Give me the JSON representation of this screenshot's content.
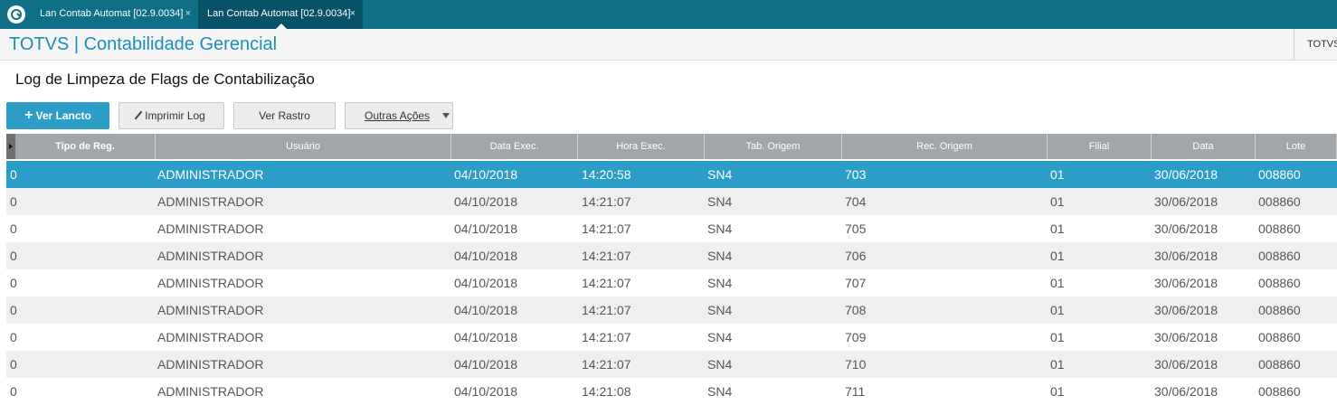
{
  "tabs": [
    {
      "label": "Lan Contab Automat [02.9.0034]",
      "close": "×"
    },
    {
      "label": "Lan Contab Automat [02.9.0034]",
      "close": "×"
    }
  ],
  "header": {
    "brand": "TOTVS | Contabilidade Gerencial",
    "right_label": "TOTVS"
  },
  "page_title": "Log de Limpeza de Flags de Contabilização",
  "toolbar": {
    "primary": {
      "icon": "+",
      "label": "Ver Lancto"
    },
    "print": {
      "label": "Imprimir Log"
    },
    "trace": {
      "label": "Ver Rastro"
    },
    "more": {
      "label": "Outras Ações"
    }
  },
  "columns": [
    "Tipo de Reg.",
    "Usuário",
    "Data Exec.",
    "Hora Exec.",
    "Tab. Origem",
    "Rec. Origem",
    "Filial",
    "Data",
    "Lote"
  ],
  "rows": [
    [
      "0",
      "ADMINISTRADOR",
      "04/10/2018",
      "14:20:58",
      "SN4",
      "703",
      "01",
      "30/06/2018",
      "008860"
    ],
    [
      "0",
      "ADMINISTRADOR",
      "04/10/2018",
      "14:21:07",
      "SN4",
      "704",
      "01",
      "30/06/2018",
      "008860"
    ],
    [
      "0",
      "ADMINISTRADOR",
      "04/10/2018",
      "14:21:07",
      "SN4",
      "705",
      "01",
      "30/06/2018",
      "008860"
    ],
    [
      "0",
      "ADMINISTRADOR",
      "04/10/2018",
      "14:21:07",
      "SN4",
      "706",
      "01",
      "30/06/2018",
      "008860"
    ],
    [
      "0",
      "ADMINISTRADOR",
      "04/10/2018",
      "14:21:07",
      "SN4",
      "707",
      "01",
      "30/06/2018",
      "008860"
    ],
    [
      "0",
      "ADMINISTRADOR",
      "04/10/2018",
      "14:21:07",
      "SN4",
      "708",
      "01",
      "30/06/2018",
      "008860"
    ],
    [
      "0",
      "ADMINISTRADOR",
      "04/10/2018",
      "14:21:07",
      "SN4",
      "709",
      "01",
      "30/06/2018",
      "008860"
    ],
    [
      "0",
      "ADMINISTRADOR",
      "04/10/2018",
      "14:21:07",
      "SN4",
      "710",
      "01",
      "30/06/2018",
      "008860"
    ],
    [
      "0",
      "ADMINISTRADOR",
      "04/10/2018",
      "14:21:08",
      "SN4",
      "711",
      "01",
      "30/06/2018",
      "008860"
    ]
  ],
  "colors": {
    "topbar": "#0e6f86",
    "accent": "#2b9dc6",
    "header_row": "#a3a6a8"
  }
}
